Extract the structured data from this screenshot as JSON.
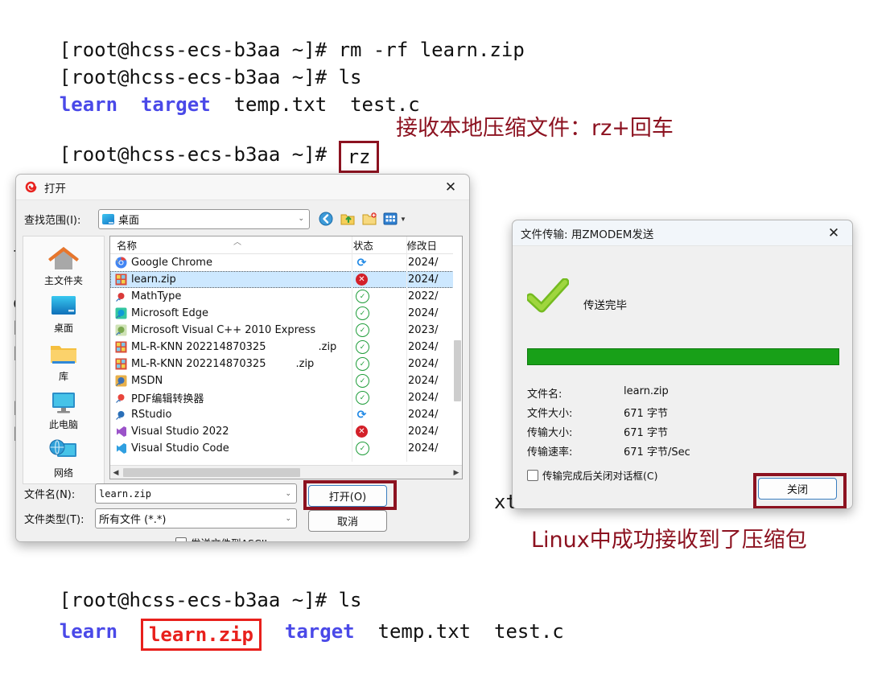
{
  "terminal": {
    "lines": [
      {
        "prompt": "[root@hcss-ecs-b3aa ~]# ",
        "cmd": "rm -rf learn.zip"
      },
      {
        "prompt": "[root@hcss-ecs-b3aa ~]# ",
        "cmd": "ls"
      }
    ],
    "ls_out_1": {
      "dir1": "learn",
      "dir2": "target",
      "f1": "temp.txt",
      "f2": "test.c"
    },
    "rz_prompt": "[root@hcss-ecs-b3aa ~]# ",
    "rz_cmd": "rz",
    "bottom_prompt": "[root@hcss-ecs-b3aa ~]# ",
    "bottom_cmd": "ls",
    "ls_out_2": {
      "dir1": "learn",
      "zip": "learn.zip",
      "dir2": "target",
      "f1": "temp.txt",
      "f2": "test.c"
    },
    "ghost_right": "xt   test.c",
    "colors": {
      "dir": "#4a49e8",
      "text": "#101010",
      "annot": "#8c1220",
      "zip_box": "#e8201c"
    }
  },
  "annotations": {
    "top": "接收本地压缩文件：rz+回车",
    "bottom": "Linux中成功接收到了压缩包"
  },
  "open_dialog": {
    "title": "打开",
    "title_icon": "xshell-spiral-icon",
    "close_label": "✕",
    "lookin_label": "查找范围(I):",
    "lookin_value": "桌面",
    "toolbar": [
      "back-icon",
      "up-folder-icon",
      "new-folder-icon",
      "view-mode-icon"
    ],
    "places": [
      {
        "label": "主文件夹",
        "icon": "home-icon"
      },
      {
        "label": "桌面",
        "icon": "desktop-icon"
      },
      {
        "label": "库",
        "icon": "library-folder-icon"
      },
      {
        "label": "此电脑",
        "icon": "this-pc-icon"
      },
      {
        "label": "网络",
        "icon": "network-icon"
      }
    ],
    "columns": {
      "name": "名称",
      "state": "状态",
      "date": "修改日"
    },
    "files": [
      {
        "name": "Google Chrome",
        "ext": "",
        "icon": "chrome-icon",
        "state": "sync",
        "date": "2024/"
      },
      {
        "name": "learn.zip",
        "ext": "",
        "icon": "zip-icon",
        "state": "error",
        "date": "2024/",
        "selected": true
      },
      {
        "name": "MathType",
        "ext": "",
        "icon": "mathtype-icon",
        "state": "ok",
        "date": "2022/"
      },
      {
        "name": "Microsoft Edge",
        "ext": "",
        "icon": "edge-icon",
        "state": "ok",
        "date": "2024/"
      },
      {
        "name": "Microsoft Visual C++ 2010 Express",
        "ext": "",
        "icon": "vcpp-icon",
        "state": "ok",
        "date": "2023/"
      },
      {
        "name": "ML-R-KNN 202214870325",
        "ext": ".zip",
        "icon": "zip-icon",
        "state": "ok",
        "date": "2024/"
      },
      {
        "name": "ML-R-KNN 202214870325",
        "ext": ".zip",
        "icon": "zip-icon",
        "state": "ok",
        "date": "2024/"
      },
      {
        "name": "MSDN",
        "ext": "",
        "icon": "msdn-icon",
        "state": "ok",
        "date": "2024/"
      },
      {
        "name": "PDF编辑转换器",
        "ext": "",
        "icon": "pdf-icon",
        "state": "ok",
        "date": "2024/"
      },
      {
        "name": "RStudio",
        "ext": "",
        "icon": "rstudio-icon",
        "state": "sync",
        "date": "2024/"
      },
      {
        "name": "Visual Studio 2022",
        "ext": "",
        "icon": "vs-icon",
        "state": "error",
        "date": "2024/"
      },
      {
        "name": "Visual Studio Code",
        "ext": "",
        "icon": "vscode-icon",
        "state": "ok",
        "date": "2024/"
      }
    ],
    "filename_label": "文件名(N):",
    "filename_value": "learn.zip",
    "filetype_label": "文件类型(T):",
    "filetype_value": "所有文件 (*.*)",
    "open_button": "打开(O)",
    "cancel_button": "取消",
    "ascii_checkbox": "发送文件到ASCII"
  },
  "zmodem_dialog": {
    "title": "文件传输: 用ZMODEM发送",
    "close_label": "✕",
    "status": "传送完毕",
    "status_icon": "green-check-icon",
    "progress_percent": 100,
    "progress_color": "#18a018",
    "rows": [
      {
        "key": "文件名:",
        "value": "learn.zip"
      },
      {
        "key": "文件大小:",
        "value": "671 字节"
      },
      {
        "key": "传输大小:",
        "value": "671 字节"
      },
      {
        "key": "传输速率:",
        "value": "671 字节/Sec"
      }
    ],
    "auto_close_checkbox": "传输完成后关闭对话框(C)",
    "close_button": "关闭"
  }
}
